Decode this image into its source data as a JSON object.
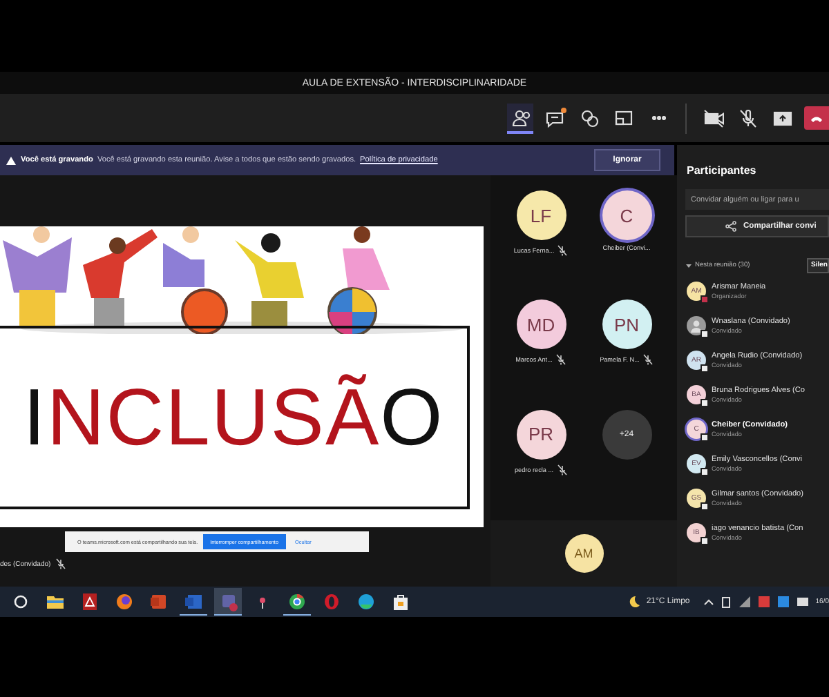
{
  "window": {
    "title": "AULA DE EXTENSÃO - INTERDISCIPLINARIDADE"
  },
  "toolbar": [
    {
      "kind": "people",
      "selected": true
    },
    {
      "kind": "chat",
      "selected": false,
      "notification": true
    },
    {
      "kind": "reactions",
      "selected": false
    },
    {
      "kind": "rooms",
      "selected": false
    },
    {
      "kind": "more",
      "selected": false
    },
    {
      "kind": "camera-off",
      "selected": false
    },
    {
      "kind": "mic-off",
      "selected": false
    },
    {
      "kind": "share",
      "selected": false
    },
    {
      "kind": "hangup"
    }
  ],
  "recording_banner": {
    "title": "Você está gravando",
    "message": "Você está gravando esta reunião. Avise a todos que estão sendo gravados.",
    "link": "Política de privacidade",
    "button": "Ignorar"
  },
  "slide": {
    "title_parts": [
      {
        "text": "I",
        "kind": "dark"
      },
      {
        "text": "NCLUSÃ",
        "kind": "accent"
      },
      {
        "text": "O",
        "kind": "dark"
      }
    ]
  },
  "share_bar": {
    "message": "O teams.microsoft.com está compartilhando sua tela.",
    "stop_button": "Interromper compartilhamento",
    "hide_button": "Ocultar"
  },
  "presenter_caption": {
    "name": "des (Convidado)",
    "muted": true
  },
  "video_tiles": [
    {
      "initials": "LF",
      "name": "Lucas Ferna...",
      "color": "#f6e8aa",
      "speaking": false,
      "muted": true
    },
    {
      "initials": "C",
      "name": "Cheiber (Convi...",
      "color": "#f4d6da",
      "speaking": true,
      "muted": false
    },
    {
      "initials": "MD",
      "name": "Marcos Ant...",
      "color": "#f3cbdc",
      "speaking": false,
      "muted": true
    },
    {
      "initials": "PN",
      "name": "Pamela F. N...",
      "color": "#d2f0f2",
      "speaking": false,
      "muted": true
    },
    {
      "initials": "PR",
      "name": "pedro recla ...",
      "color": "#f4d6da",
      "speaking": false,
      "muted": true
    }
  ],
  "overflow_count": "+24",
  "self_tile": {
    "initials": "AM",
    "color": "#f6e3a3"
  },
  "participants": {
    "title": "Participantes",
    "invite_placeholder": "Convidar alguém ou ligar para u",
    "share_button": "Compartilhar convi",
    "section": {
      "label": "Nesta reunião (30)",
      "expanded": true
    },
    "mute_all_button": "Silen",
    "people": [
      {
        "initials": "AM",
        "name": "Arismar Maneia",
        "role": "Organizador",
        "color": "#f6e3a3",
        "badge": {
          "color": "#c4314b"
        },
        "speaking": false
      },
      {
        "name": "Wnaslana (Convidado)",
        "role": "Convidado",
        "color": "#9a9a9a",
        "badge": {
          "color": "#eeeeee"
        },
        "speaking": false
      },
      {
        "initials": "AR",
        "name": "Angela Rudio (Convidado)",
        "role": "Convidado",
        "color": "#cfe2ef",
        "badge": {
          "color": "#eeeeee"
        },
        "speaking": false
      },
      {
        "initials": "BA",
        "name": "Bruna Rodrigues Alves (Co",
        "role": "Convidado",
        "color": "#f3d0d8",
        "badge": {
          "color": "#eeeeee"
        },
        "speaking": false
      },
      {
        "initials": "C",
        "name": "Cheiber (Convidado)",
        "role": "Convidado",
        "color": "#f4d6da",
        "badge": {
          "color": "#eeeeee"
        },
        "speaking": true
      },
      {
        "initials": "EV",
        "name": "Emily Vasconcellos (Convi",
        "role": "Convidado",
        "color": "#d2e9f1",
        "badge": {
          "color": "#eeeeee"
        },
        "speaking": false
      },
      {
        "initials": "GS",
        "name": "Gilmar santos (Convidado)",
        "role": "Convidado",
        "color": "#f4e4ab",
        "badge": {
          "color": "#eeeeee"
        },
        "speaking": false
      },
      {
        "initials": "IB",
        "name": "iago venancio batista (Con",
        "role": "Convidado",
        "color": "#f3d2d2",
        "badge": {
          "color": "#eeeeee"
        },
        "speaking": false
      }
    ]
  },
  "taskbar": {
    "apps": [
      {
        "kind": "search",
        "open": false,
        "selected": false
      },
      {
        "kind": "folder",
        "open": false,
        "selected": false
      },
      {
        "kind": "pdf",
        "open": false,
        "selected": false
      },
      {
        "kind": "fox",
        "open": false,
        "selected": false
      },
      {
        "kind": "slides",
        "open": false,
        "selected": false
      },
      {
        "kind": "word",
        "open": true,
        "selected": false
      },
      {
        "kind": "teams",
        "open": true,
        "selected": true
      },
      {
        "kind": "dot",
        "open": false,
        "selected": false
      },
      {
        "kind": "chrome",
        "open": true,
        "selected": false
      },
      {
        "kind": "opera",
        "open": false,
        "selected": false
      },
      {
        "kind": "edge",
        "open": false,
        "selected": false
      },
      {
        "kind": "store",
        "open": false,
        "selected": false
      }
    ],
    "weather": "21°C Limpo",
    "clock": "16/0"
  }
}
